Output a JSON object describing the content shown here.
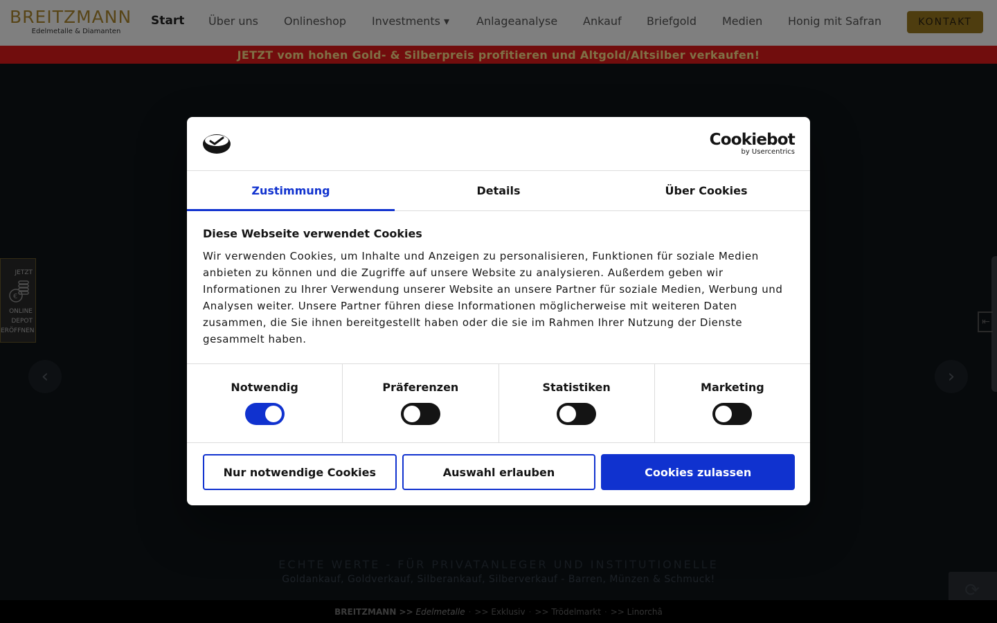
{
  "header": {
    "logo_name": "BREITZMANN",
    "logo_sub": "Edelmetalle & Diamanten",
    "nav_active": "Start",
    "nav": [
      {
        "label": "Über uns"
      },
      {
        "label": "Onlineshop"
      },
      {
        "label": "Investments ▾"
      },
      {
        "label": "Anlageanalyse"
      },
      {
        "label": "Ankauf"
      },
      {
        "label": "Briefgold"
      },
      {
        "label": "Medien"
      },
      {
        "label": "Honig mit Safran"
      }
    ],
    "contact_label": "KONTAKT"
  },
  "promo": {
    "text": "JETZT vom hohen Gold- & Silberpreis profitieren und Altgold/Altsilber verkaufen!"
  },
  "depot": {
    "line1": "JETZT",
    "line2": "ONLINE",
    "line3": "DEPOT",
    "line4": "ERÖFFNEN"
  },
  "hero": {
    "tagline": "ECHTE WERTE - FÜR PRIVATANLEGER UND INSTITUTIONELLE",
    "subline": "Goldankauf, Goldverkauf, Silberankauf, Silberverkauf - Barren, Münzen & Schmuck!",
    "prev_icon": "chevron-left-icon",
    "next_icon": "chevron-right-icon"
  },
  "footer": {
    "brand": "BREITZMANN >>",
    "brand_sub": "Edelmetalle",
    "links": [
      ">> Exklusiv",
      ">> Trödelmarkt",
      ">> Linorchâ"
    ]
  },
  "cookie_dialog": {
    "brand_main": "Cookiebot",
    "brand_sub": "by Usercentrics",
    "tabs": [
      {
        "label": "Zustimmung",
        "active": true
      },
      {
        "label": "Details",
        "active": false
      },
      {
        "label": "Über Cookies",
        "active": false
      }
    ],
    "title": "Diese Webseite verwendet Cookies",
    "text": "Wir verwenden Cookies, um Inhalte und Anzeigen zu personalisieren, Funktionen für soziale Medien anbieten zu können und die Zugriffe auf unsere Website zu analysieren. Außerdem geben wir Informationen zu Ihrer Verwendung unserer Website an unsere Partner für soziale Medien, Werbung und Analysen weiter. Unsere Partner führen diese Informationen möglicherweise mit weiteren Daten zusammen, die Sie ihnen bereitgestellt haben oder die sie im Rahmen Ihrer Nutzung der Dienste gesammelt haben.",
    "toggles": [
      {
        "label": "Notwendig",
        "on": true
      },
      {
        "label": "Präferenzen",
        "on": false
      },
      {
        "label": "Statistiken",
        "on": false
      },
      {
        "label": "Marketing",
        "on": false
      }
    ],
    "buttons": {
      "necessary": "Nur notwendige Cookies",
      "selection": "Auswahl erlauben",
      "all": "Cookies zulassen"
    }
  },
  "colors": {
    "accent": "#1032cf",
    "promo_bg": "#e21b1b",
    "promo_text": "#ffe08a",
    "gold": "#b08a2e"
  }
}
